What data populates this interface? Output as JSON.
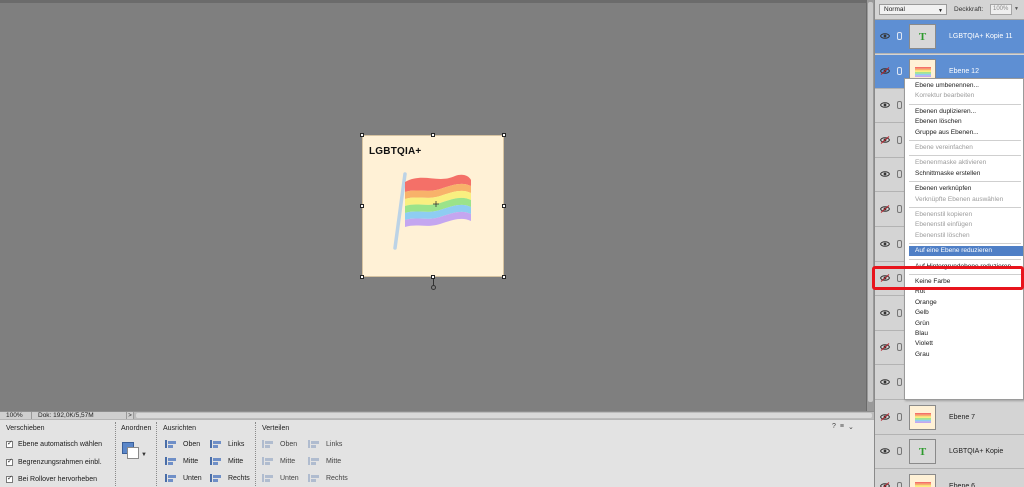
{
  "statusbar": {
    "zoom": "100%",
    "doc_info": "Dok: 192,0K/5,57M",
    "arrow": ">"
  },
  "document": {
    "title_text": "LGBTQIA+"
  },
  "options": {
    "move": {
      "title": "Verschieben",
      "checks": [
        "Ebene automatisch wählen",
        "Begrenzungsrahmen einbl.",
        "Bei Rollover hervorheben"
      ]
    },
    "arrange": {
      "title": "Anordnen"
    },
    "align": {
      "title": "Ausrichten",
      "left_col": [
        "Oben",
        "Mitte",
        "Unten"
      ],
      "right_col": [
        "Links",
        "Mitte",
        "Rechts"
      ]
    },
    "distribute": {
      "title": "Verteilen",
      "left_col": [
        "Oben",
        "Mitte",
        "Unten"
      ],
      "right_col": [
        "Links",
        "Mitte",
        "Rechts"
      ]
    }
  },
  "panel": {
    "blend_mode": "Normal",
    "opacity_label": "Deckkraft:",
    "opacity_value": "100%",
    "layers": [
      {
        "name": "LGBTQIA+ Kopie 11",
        "type": "text",
        "visible": true,
        "selected": true
      },
      {
        "name": "Ebene 12",
        "type": "image",
        "visible": false,
        "selected": true
      },
      {
        "name": "",
        "type": "image",
        "visible": true,
        "selected": false
      },
      {
        "name": "",
        "type": "image",
        "visible": false,
        "selected": false
      },
      {
        "name": "",
        "type": "image",
        "visible": true,
        "selected": false
      },
      {
        "name": "",
        "type": "image",
        "visible": false,
        "selected": false
      },
      {
        "name": "",
        "type": "image",
        "visible": true,
        "selected": false
      },
      {
        "name": "",
        "type": "image",
        "visible": false,
        "selected": false
      },
      {
        "name": "",
        "type": "image",
        "visible": true,
        "selected": false
      },
      {
        "name": "",
        "type": "image",
        "visible": false,
        "selected": false
      },
      {
        "name": "",
        "type": "image",
        "visible": true,
        "selected": false
      },
      {
        "name": "Ebene 7",
        "type": "image",
        "visible": false,
        "selected": false
      },
      {
        "name": "LGBTQIA+ Kopie",
        "type": "text",
        "visible": true,
        "selected": false
      },
      {
        "name": "Ebene 6",
        "type": "image",
        "visible": false,
        "selected": false
      }
    ],
    "text_thumb_glyph": "T"
  },
  "context_menu": {
    "items": [
      {
        "label": "Ebene umbenennen...",
        "disabled": false
      },
      {
        "label": "Korrektur bearbeiten",
        "disabled": true
      },
      {
        "sep": true
      },
      {
        "label": "Ebenen duplizieren...",
        "disabled": false
      },
      {
        "label": "Ebenen löschen",
        "disabled": false
      },
      {
        "label": "Gruppe aus Ebenen...",
        "disabled": false
      },
      {
        "sep": true
      },
      {
        "label": "Ebene vereinfachen",
        "disabled": true
      },
      {
        "sep": true
      },
      {
        "label": "Ebenenmaske aktivieren",
        "disabled": true
      },
      {
        "label": "Schnittmaske erstellen",
        "disabled": false
      },
      {
        "sep": true
      },
      {
        "label": "Ebenen verknüpfen",
        "disabled": false
      },
      {
        "label": "Verknüpfte Ebenen auswählen",
        "disabled": true
      },
      {
        "sep": true
      },
      {
        "label": "Ebenenstil kopieren",
        "disabled": true
      },
      {
        "label": "Ebenenstil einfügen",
        "disabled": true
      },
      {
        "label": "Ebenenstil löschen",
        "disabled": true
      },
      {
        "sep": true
      },
      {
        "label": "Auf eine Ebene reduzieren",
        "disabled": false,
        "highlighted": true
      },
      {
        "sep": true
      },
      {
        "label": "Auf Hintergrundebene reduzieren",
        "disabled": false
      },
      {
        "sep": true
      },
      {
        "label": "Keine Farbe",
        "disabled": false
      },
      {
        "label": "Rot",
        "disabled": false
      },
      {
        "label": "Orange",
        "disabled": false
      },
      {
        "label": "Gelb",
        "disabled": false
      },
      {
        "label": "Grün",
        "disabled": false
      },
      {
        "label": "Blau",
        "disabled": false
      },
      {
        "label": "Violett",
        "disabled": false
      },
      {
        "label": "Grau",
        "disabled": false
      }
    ]
  },
  "colors": {
    "highlight": "#4f7fc6",
    "selected_layer": "#5e8fd3",
    "annotation_red": "#e8141c",
    "doc_bg": "#fff1d6"
  }
}
